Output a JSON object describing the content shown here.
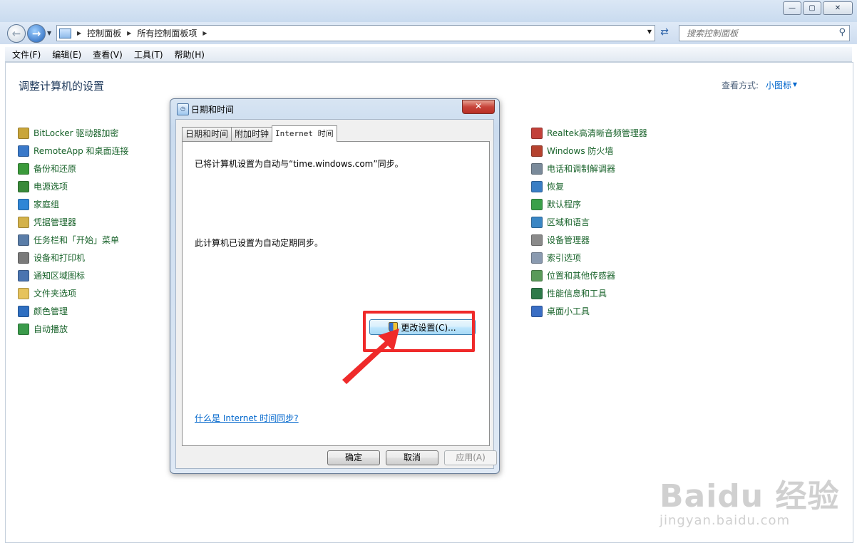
{
  "window": {
    "controls": {
      "minimize": "—",
      "maximize": "▢",
      "close": "✕"
    }
  },
  "nav": {
    "breadcrumbs": [
      "控制面板",
      "所有控制面板项"
    ],
    "search_placeholder": "搜索控制面板"
  },
  "menu": [
    "文件(F)",
    "编辑(E)",
    "查看(V)",
    "工具(T)",
    "帮助(H)"
  ],
  "content": {
    "title": "调整计算机的设置",
    "view_by_label": "查看方式:",
    "view_by_value": "小图标"
  },
  "left_items": [
    {
      "label": "BitLocker 驱动器加密",
      "icon": "bitlocker-icon",
      "color": "#c9a53a"
    },
    {
      "label": "RemoteApp 和桌面连接",
      "icon": "remoteapp-icon",
      "color": "#3a79c9"
    },
    {
      "label": "备份和还原",
      "icon": "backup-icon",
      "color": "#3b9a3b"
    },
    {
      "label": "电源选项",
      "icon": "power-icon",
      "color": "#3a8a3a"
    },
    {
      "label": "家庭组",
      "icon": "homegroup-icon",
      "color": "#2f86d6"
    },
    {
      "label": "凭据管理器",
      "icon": "credential-icon",
      "color": "#d4b24a"
    },
    {
      "label": "任务栏和「开始」菜单",
      "icon": "taskbar-icon",
      "color": "#5a7da8"
    },
    {
      "label": "设备和打印机",
      "icon": "printer-icon",
      "color": "#7a7a7a"
    },
    {
      "label": "通知区域图标",
      "icon": "notification-icon",
      "color": "#4a74b0"
    },
    {
      "label": "文件夹选项",
      "icon": "folder-icon",
      "color": "#e6c35c"
    },
    {
      "label": "颜色管理",
      "icon": "color-icon",
      "color": "#2f6fc1"
    },
    {
      "label": "自动播放",
      "icon": "autoplay-icon",
      "color": "#3a9a4a"
    }
  ],
  "right_items": [
    {
      "label": "Realtek高清晰音频管理器",
      "icon": "realtek-icon",
      "color": "#c2413a"
    },
    {
      "label": "Windows 防火墙",
      "icon": "firewall-icon",
      "color": "#b5422f"
    },
    {
      "label": "电话和调制解调器",
      "icon": "modem-icon",
      "color": "#7a8a9a"
    },
    {
      "label": "恢复",
      "icon": "recovery-icon",
      "color": "#3a7ec4"
    },
    {
      "label": "默认程序",
      "icon": "default-programs-icon",
      "color": "#3aa04a"
    },
    {
      "label": "区域和语言",
      "icon": "region-icon",
      "color": "#3a86c4"
    },
    {
      "label": "设备管理器",
      "icon": "device-manager-icon",
      "color": "#8a8a8a"
    },
    {
      "label": "索引选项",
      "icon": "indexing-icon",
      "color": "#8a9ab0"
    },
    {
      "label": "位置和其他传感器",
      "icon": "sensor-icon",
      "color": "#5a9a5a"
    },
    {
      "label": "性能信息和工具",
      "icon": "performance-icon",
      "color": "#2e7a4a"
    },
    {
      "label": "桌面小工具",
      "icon": "gadgets-icon",
      "color": "#3a6ec4"
    }
  ],
  "dialog": {
    "title": "日期和时间",
    "close": "✕",
    "tabs": [
      "日期和时间",
      "附加时钟",
      "Internet 时间"
    ],
    "message1": "已将计算机设置为自动与“time.windows.com”同步。",
    "message2": "此计算机已设置为自动定期同步。",
    "change_button": "更改设置(C)...",
    "help_link": "什么是 Internet 时间同步?",
    "ok": "确定",
    "cancel": "取消",
    "apply": "应用(A)"
  },
  "watermark": {
    "logo": "Baidu 经验",
    "url": "jingyan.baidu.com"
  },
  "colors": {
    "highlight": "#ef2a2a",
    "link": "#0066cc",
    "item_text": "#19632b"
  }
}
